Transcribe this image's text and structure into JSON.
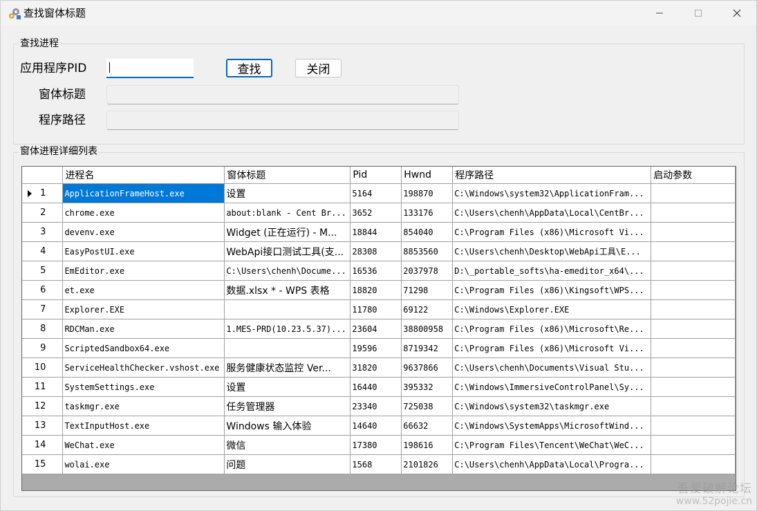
{
  "window": {
    "title": "查找窗体标题",
    "icon": "gears-icon"
  },
  "search_group": {
    "legend": "查找进程",
    "pid_label": "应用程序PID",
    "pid_value": "",
    "window_title_label": "窗体标题",
    "program_path_label": "程序路径",
    "find_button": "查找",
    "close_button": "关闭"
  },
  "list_group": {
    "legend": "窗体进程详细列表"
  },
  "grid": {
    "columns": [
      "进程名",
      "窗体标题",
      "Pid",
      "Hwnd",
      "程序路径",
      "启动参数"
    ],
    "rows": [
      {
        "index": "1",
        "name": "ApplicationFrameHost.exe",
        "title": "设置",
        "pid": "5164",
        "hwnd": "198870",
        "path": "C:\\Windows\\system32\\ApplicationFram...",
        "args": ""
      },
      {
        "index": "2",
        "name": "chrome.exe",
        "title": "about:blank - Cent Br...",
        "pid": "3652",
        "hwnd": "133176",
        "path": "C:\\Users\\chenh\\AppData\\Local\\CentBr...",
        "args": ""
      },
      {
        "index": "3",
        "name": "devenv.exe",
        "title": "Widget (正在运行) - M...",
        "pid": "18844",
        "hwnd": "854040",
        "path": "C:\\Program Files (x86)\\Microsoft Vi...",
        "args": ""
      },
      {
        "index": "4",
        "name": "EasyPostUI.exe",
        "title": "WebApi接口测试工具(支...",
        "pid": "28308",
        "hwnd": "8853560",
        "path": "C:\\Users\\chenh\\Desktop\\WebApi工具\\E...",
        "args": ""
      },
      {
        "index": "5",
        "name": "EmEditor.exe",
        "title": "C:\\Users\\chenh\\Docume...",
        "pid": "16536",
        "hwnd": "2037978",
        "path": "D:\\_portable_softs\\ha-emeditor_x64\\...",
        "args": ""
      },
      {
        "index": "6",
        "name": "et.exe",
        "title": "数据.xlsx * - WPS 表格",
        "pid": "18820",
        "hwnd": "71298",
        "path": "C:\\Program Files (x86)\\Kingsoft\\WPS...",
        "args": ""
      },
      {
        "index": "7",
        "name": "Explorer.EXE",
        "title": "",
        "pid": "11780",
        "hwnd": "69122",
        "path": "C:\\Windows\\Explorer.EXE",
        "args": ""
      },
      {
        "index": "8",
        "name": "RDCMan.exe",
        "title": "1.MES-PRD(10.23.5.37)...",
        "pid": "23604",
        "hwnd": "38800958",
        "path": "C:\\Program Files (x86)\\Microsoft\\Re...",
        "args": ""
      },
      {
        "index": "9",
        "name": "ScriptedSandbox64.exe",
        "title": "",
        "pid": "19596",
        "hwnd": "8719342",
        "path": "C:\\Program Files (x86)\\Microsoft Vi...",
        "args": ""
      },
      {
        "index": "10",
        "name": "ServiceHealthChecker.vshost.exe",
        "title": "服务健康状态监控  Ver...",
        "pid": "31820",
        "hwnd": "9637866",
        "path": "C:\\Users\\chenh\\Documents\\Visual Stu...",
        "args": ""
      },
      {
        "index": "11",
        "name": "SystemSettings.exe",
        "title": "设置",
        "pid": "16440",
        "hwnd": "395332",
        "path": "C:\\Windows\\ImmersiveControlPanel\\Sy...",
        "args": ""
      },
      {
        "index": "12",
        "name": "taskmgr.exe",
        "title": "任务管理器",
        "pid": "23340",
        "hwnd": "725038",
        "path": "C:\\Windows\\system32\\taskmgr.exe",
        "args": ""
      },
      {
        "index": "13",
        "name": "TextInputHost.exe",
        "title": "Windows 输入体验",
        "pid": "14640",
        "hwnd": "66632",
        "path": "C:\\Windows\\SystemApps\\MicrosoftWind...",
        "args": ""
      },
      {
        "index": "14",
        "name": "WeChat.exe",
        "title": "微信",
        "pid": "17380",
        "hwnd": "198616",
        "path": "C:\\Program Files\\Tencent\\WeChat\\WeC...",
        "args": ""
      },
      {
        "index": "15",
        "name": "wolai.exe",
        "title": "问题",
        "pid": "1568",
        "hwnd": "2101826",
        "path": "C:\\Users\\chenh\\AppData\\Local\\Progra...",
        "args": ""
      }
    ],
    "selected_row": 0
  },
  "watermark": {
    "line1": "吾爱破解论坛",
    "line2": "www.52pojie.cn"
  },
  "colors": {
    "selection": "#0078d7",
    "focus_border": "#0067c0"
  }
}
